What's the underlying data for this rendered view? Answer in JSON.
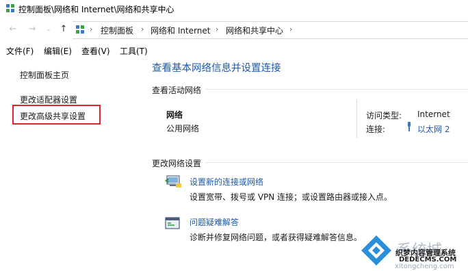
{
  "window": {
    "title": "控制面板\\网络和 Internet\\网络和共享中心"
  },
  "address": {
    "crumbs": [
      "控制面板",
      "网络和 Internet",
      "网络和共享中心"
    ]
  },
  "menu": [
    "文件(F)",
    "编辑(E)",
    "查看(V)",
    "工具(T)"
  ],
  "sidebar": {
    "items": [
      {
        "label": "控制面板主页"
      },
      {
        "label": "更改适配器设置"
      },
      {
        "label": "更改高级共享设置",
        "highlighted": true
      }
    ]
  },
  "main": {
    "heading": "查看基本网络信息并设置连接",
    "active_section": "查看活动网络",
    "network": {
      "name": "网络",
      "type": "公用网络",
      "access_label": "访问类型:",
      "access_value": "Internet",
      "conn_label": "连接:",
      "conn_value": "以太网 2"
    },
    "change_section": "更改网络设置",
    "tasks": [
      {
        "title": "设置新的连接或网络",
        "desc": "设置宽带、拨号或 VPN 连接；或设置路由器或接入点。",
        "icon": "new-connection-icon"
      },
      {
        "title": "问题疑难解答",
        "desc": "诊断并修复网络问题，或者获得疑难解答信息。",
        "icon": "troubleshoot-icon"
      }
    ]
  },
  "watermark": {
    "text1": "系统城",
    "text2": "织梦内容管理系统",
    "text3": "DEDECMS.COM",
    "text4": "xitongcheng.com"
  },
  "colors": {
    "link": "#1e5aa8",
    "highlight": "#e0252b"
  }
}
